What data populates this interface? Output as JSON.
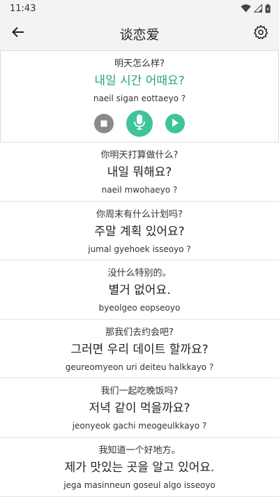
{
  "status_bar": {
    "time": "11:43"
  },
  "app_bar": {
    "title": "谈恋爱",
    "back_icon": "arrow-left-icon",
    "settings_icon": "gear-icon"
  },
  "colors": {
    "accent": "#3fc39a",
    "korean_active": "#2aa67e",
    "stop_gray": "#8a8a8a"
  },
  "active_sentence": {
    "chinese": "明天怎么样?",
    "korean": "내일 시간 어때요?",
    "romanization": "naeil sigan eottaeyo ?",
    "controls": [
      "stop-icon",
      "microphone-icon",
      "play-icon"
    ]
  },
  "sentences": [
    {
      "chinese": "你明天打算做什么?",
      "korean": "내일 뭐해요?",
      "romanization": "naeil mwohaeyo ?"
    },
    {
      "chinese": "你周末有什么计划吗?",
      "korean": "주말 계획 있어요?",
      "romanization": "jumal gyehoek isseoyo ?"
    },
    {
      "chinese": "没什么特别的。",
      "korean": "별거 없어요.",
      "romanization": "byeolgeo eopseoyo"
    },
    {
      "chinese": "那我们去约会吧?",
      "korean": "그러면 우리 데이트 할까요?",
      "romanization": "geureomyeon uri deiteu halkkayo ?"
    },
    {
      "chinese": "我们一起吃晚饭吗?",
      "korean": "저녁 같이 먹을까요?",
      "romanization": "jeonyeok gachi meogeulkkayo ?"
    },
    {
      "chinese": "我知道一个好地方。",
      "korean": "제가 맛있는 곳을 알고 있어요.",
      "romanization": "jega masinneun goseul algo isseoyo"
    }
  ]
}
